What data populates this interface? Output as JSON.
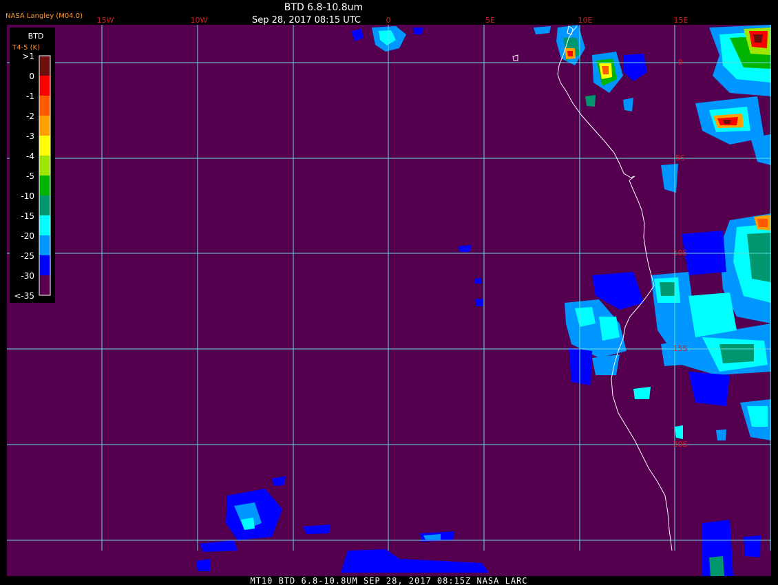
{
  "header": {
    "title": "BTD 6.8-10.8um",
    "timestamp": "Sep 28, 2017 08:15 UTC",
    "credit": "NASA Langley (M04.0)"
  },
  "legend": {
    "title": "BTD",
    "subtitle": "T4-5 (K)",
    "ticks": [
      ">1",
      "0",
      "-1",
      "-2",
      "-3",
      "-4",
      "-5",
      "-10",
      "-15",
      "-20",
      "-25",
      "-30",
      "<-35"
    ],
    "colors": [
      "#6b0f0f",
      "#ff0000",
      "#ff5a00",
      "#ffa000",
      "#ffff00",
      "#a0e600",
      "#00b400",
      "#00966e",
      "#00ffff",
      "#0096ff",
      "#0000ff",
      "#5a0050"
    ]
  },
  "grid": {
    "lon_labels": [
      "15W",
      "10W",
      "0",
      "5E",
      "10E",
      "15E"
    ],
    "lat_labels": [
      "0",
      "5S",
      "10S",
      "15S",
      "20S"
    ]
  },
  "footer": {
    "text": "MT10  BTD 6.8-10.8UM  SEP 28, 2017 08:15Z  NASA LARC"
  },
  "colors": {
    "background": "#55004f",
    "grid": "#66dddd",
    "coastline": "#ffffff"
  }
}
